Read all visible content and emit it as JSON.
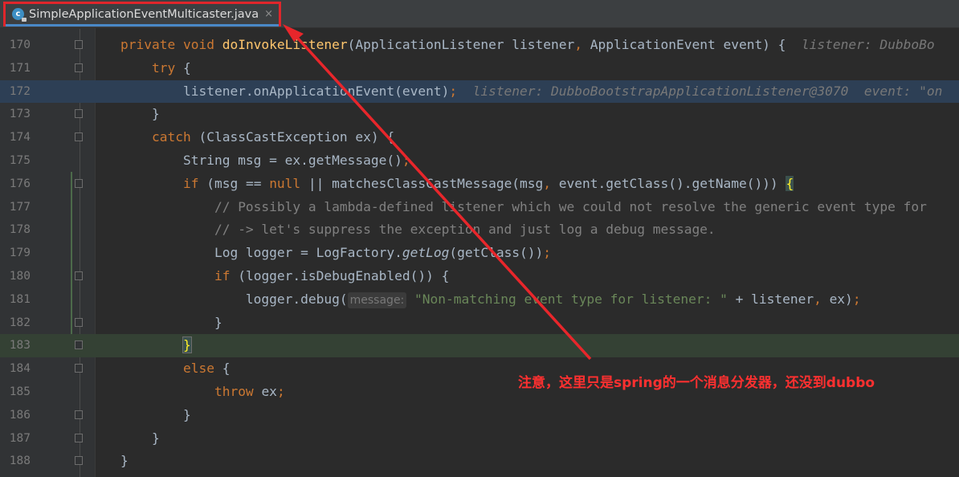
{
  "tab": {
    "icon": "java-class-icon",
    "filename": "SimpleApplicationEventMulticaster.java",
    "close_glyph": "×"
  },
  "lines": [
    {
      "num": "170",
      "tokens": [
        {
          "t": "private void ",
          "c": "kw"
        },
        {
          "t": "doInvokeListener",
          "c": "fn"
        },
        {
          "t": "(ApplicationListener listener"
        },
        {
          "t": ", ",
          "c": "kw"
        },
        {
          "t": "ApplicationEvent event) {  "
        },
        {
          "t": "listener: DubboBo",
          "c": "hint"
        }
      ]
    },
    {
      "num": "171",
      "tokens": [
        {
          "t": "    "
        },
        {
          "t": "try ",
          "c": "kw"
        },
        {
          "t": "{"
        }
      ]
    },
    {
      "num": "172",
      "tokens": [
        {
          "t": "        listener.onApplicationEvent(event)"
        },
        {
          "t": ";",
          "c": "kw"
        },
        {
          "t": "  "
        },
        {
          "t": "listener: DubboBootstrapApplicationListener@3070  event: \"on",
          "c": "hint"
        }
      ]
    },
    {
      "num": "173",
      "tokens": [
        {
          "t": "    }"
        }
      ]
    },
    {
      "num": "174",
      "tokens": [
        {
          "t": "    "
        },
        {
          "t": "catch ",
          "c": "kw"
        },
        {
          "t": "(ClassCastException ex) {"
        }
      ]
    },
    {
      "num": "175",
      "tokens": [
        {
          "t": "        String msg = ex.getMessage()"
        },
        {
          "t": ";",
          "c": "kw"
        }
      ]
    },
    {
      "num": "176",
      "tokens": [
        {
          "t": "        "
        },
        {
          "t": "if ",
          "c": "kw"
        },
        {
          "t": "(msg == "
        },
        {
          "t": "null ",
          "c": "kw"
        },
        {
          "t": "|| matchesClassCastMessage(msg"
        },
        {
          "t": ", ",
          "c": "kw"
        },
        {
          "t": "event.getClass().getName())) "
        },
        {
          "t": "{",
          "c": "brace-match"
        }
      ]
    },
    {
      "num": "177",
      "tokens": [
        {
          "t": "            "
        },
        {
          "t": "// Possibly a lambda-defined listener which we could not resolve the generic event type for",
          "c": "cm"
        }
      ]
    },
    {
      "num": "178",
      "tokens": [
        {
          "t": "            "
        },
        {
          "t": "// -> let's suppress the exception and just log a debug message.",
          "c": "cm"
        }
      ]
    },
    {
      "num": "179",
      "tokens": [
        {
          "t": "            Log logger = LogFactory."
        },
        {
          "t": "getLog",
          "c": "it"
        },
        {
          "t": "(getClass())"
        },
        {
          "t": ";",
          "c": "kw"
        }
      ]
    },
    {
      "num": "180",
      "tokens": [
        {
          "t": "            "
        },
        {
          "t": "if ",
          "c": "kw"
        },
        {
          "t": "(logger.isDebugEnabled()) {"
        }
      ]
    },
    {
      "num": "181",
      "tokens": [
        {
          "t": "                logger.debug("
        },
        {
          "t": "message:",
          "c": "ph"
        },
        {
          "t": " "
        },
        {
          "t": "\"Non-matching event type for listener: \"",
          "c": "st"
        },
        {
          "t": " + listener"
        },
        {
          "t": ", ",
          "c": "kw"
        },
        {
          "t": "ex)"
        },
        {
          "t": ";",
          "c": "kw"
        }
      ]
    },
    {
      "num": "182",
      "tokens": [
        {
          "t": "            }"
        }
      ]
    },
    {
      "num": "183",
      "tokens": [
        {
          "t": "        "
        },
        {
          "t": "}",
          "c": "brace-match-cur"
        }
      ]
    },
    {
      "num": "184",
      "tokens": [
        {
          "t": "        "
        },
        {
          "t": "else ",
          "c": "kw"
        },
        {
          "t": "{"
        }
      ]
    },
    {
      "num": "185",
      "tokens": [
        {
          "t": "            "
        },
        {
          "t": "throw ",
          "c": "kw"
        },
        {
          "t": "ex"
        },
        {
          "t": ";",
          "c": "kw"
        }
      ]
    },
    {
      "num": "186",
      "tokens": [
        {
          "t": "        }"
        }
      ]
    },
    {
      "num": "187",
      "tokens": [
        {
          "t": "    }"
        }
      ]
    },
    {
      "num": "188",
      "tokens": [
        {
          "t": "}"
        }
      ]
    }
  ],
  "annotation": {
    "text": "注意，这里只是spring的一个消息分发器，还没到dubbo",
    "color": "#ff3030"
  },
  "colors": {
    "keyword": "#cc7832",
    "method": "#ffc66d",
    "comment": "#808080",
    "string": "#6a8759",
    "default": "#a9b7c6",
    "annotation_red": "#e0262b"
  }
}
